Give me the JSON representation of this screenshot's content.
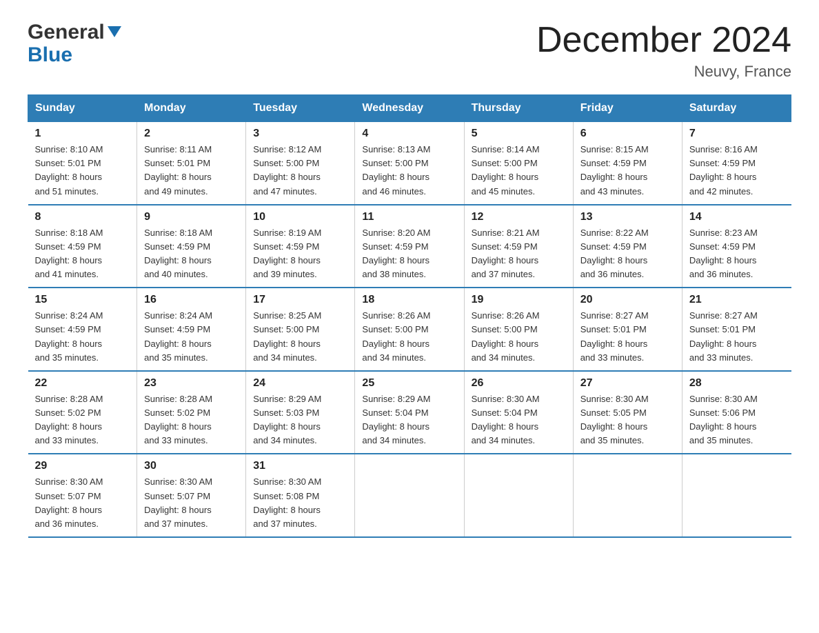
{
  "header": {
    "logo_general": "General",
    "logo_blue": "Blue",
    "title": "December 2024",
    "subtitle": "Neuvy, France"
  },
  "days_of_week": [
    "Sunday",
    "Monday",
    "Tuesday",
    "Wednesday",
    "Thursday",
    "Friday",
    "Saturday"
  ],
  "weeks": [
    [
      {
        "day": "1",
        "sunrise": "8:10 AM",
        "sunset": "5:01 PM",
        "daylight": "8 hours and 51 minutes."
      },
      {
        "day": "2",
        "sunrise": "8:11 AM",
        "sunset": "5:01 PM",
        "daylight": "8 hours and 49 minutes."
      },
      {
        "day": "3",
        "sunrise": "8:12 AM",
        "sunset": "5:00 PM",
        "daylight": "8 hours and 47 minutes."
      },
      {
        "day": "4",
        "sunrise": "8:13 AM",
        "sunset": "5:00 PM",
        "daylight": "8 hours and 46 minutes."
      },
      {
        "day": "5",
        "sunrise": "8:14 AM",
        "sunset": "5:00 PM",
        "daylight": "8 hours and 45 minutes."
      },
      {
        "day": "6",
        "sunrise": "8:15 AM",
        "sunset": "4:59 PM",
        "daylight": "8 hours and 43 minutes."
      },
      {
        "day": "7",
        "sunrise": "8:16 AM",
        "sunset": "4:59 PM",
        "daylight": "8 hours and 42 minutes."
      }
    ],
    [
      {
        "day": "8",
        "sunrise": "8:18 AM",
        "sunset": "4:59 PM",
        "daylight": "8 hours and 41 minutes."
      },
      {
        "day": "9",
        "sunrise": "8:18 AM",
        "sunset": "4:59 PM",
        "daylight": "8 hours and 40 minutes."
      },
      {
        "day": "10",
        "sunrise": "8:19 AM",
        "sunset": "4:59 PM",
        "daylight": "8 hours and 39 minutes."
      },
      {
        "day": "11",
        "sunrise": "8:20 AM",
        "sunset": "4:59 PM",
        "daylight": "8 hours and 38 minutes."
      },
      {
        "day": "12",
        "sunrise": "8:21 AM",
        "sunset": "4:59 PM",
        "daylight": "8 hours and 37 minutes."
      },
      {
        "day": "13",
        "sunrise": "8:22 AM",
        "sunset": "4:59 PM",
        "daylight": "8 hours and 36 minutes."
      },
      {
        "day": "14",
        "sunrise": "8:23 AM",
        "sunset": "4:59 PM",
        "daylight": "8 hours and 36 minutes."
      }
    ],
    [
      {
        "day": "15",
        "sunrise": "8:24 AM",
        "sunset": "4:59 PM",
        "daylight": "8 hours and 35 minutes."
      },
      {
        "day": "16",
        "sunrise": "8:24 AM",
        "sunset": "4:59 PM",
        "daylight": "8 hours and 35 minutes."
      },
      {
        "day": "17",
        "sunrise": "8:25 AM",
        "sunset": "5:00 PM",
        "daylight": "8 hours and 34 minutes."
      },
      {
        "day": "18",
        "sunrise": "8:26 AM",
        "sunset": "5:00 PM",
        "daylight": "8 hours and 34 minutes."
      },
      {
        "day": "19",
        "sunrise": "8:26 AM",
        "sunset": "5:00 PM",
        "daylight": "8 hours and 34 minutes."
      },
      {
        "day": "20",
        "sunrise": "8:27 AM",
        "sunset": "5:01 PM",
        "daylight": "8 hours and 33 minutes."
      },
      {
        "day": "21",
        "sunrise": "8:27 AM",
        "sunset": "5:01 PM",
        "daylight": "8 hours and 33 minutes."
      }
    ],
    [
      {
        "day": "22",
        "sunrise": "8:28 AM",
        "sunset": "5:02 PM",
        "daylight": "8 hours and 33 minutes."
      },
      {
        "day": "23",
        "sunrise": "8:28 AM",
        "sunset": "5:02 PM",
        "daylight": "8 hours and 33 minutes."
      },
      {
        "day": "24",
        "sunrise": "8:29 AM",
        "sunset": "5:03 PM",
        "daylight": "8 hours and 34 minutes."
      },
      {
        "day": "25",
        "sunrise": "8:29 AM",
        "sunset": "5:04 PM",
        "daylight": "8 hours and 34 minutes."
      },
      {
        "day": "26",
        "sunrise": "8:30 AM",
        "sunset": "5:04 PM",
        "daylight": "8 hours and 34 minutes."
      },
      {
        "day": "27",
        "sunrise": "8:30 AM",
        "sunset": "5:05 PM",
        "daylight": "8 hours and 35 minutes."
      },
      {
        "day": "28",
        "sunrise": "8:30 AM",
        "sunset": "5:06 PM",
        "daylight": "8 hours and 35 minutes."
      }
    ],
    [
      {
        "day": "29",
        "sunrise": "8:30 AM",
        "sunset": "5:07 PM",
        "daylight": "8 hours and 36 minutes."
      },
      {
        "day": "30",
        "sunrise": "8:30 AM",
        "sunset": "5:07 PM",
        "daylight": "8 hours and 37 minutes."
      },
      {
        "day": "31",
        "sunrise": "8:30 AM",
        "sunset": "5:08 PM",
        "daylight": "8 hours and 37 minutes."
      },
      null,
      null,
      null,
      null
    ]
  ],
  "labels": {
    "sunrise_prefix": "Sunrise: ",
    "sunset_prefix": "Sunset: ",
    "daylight_prefix": "Daylight: "
  }
}
